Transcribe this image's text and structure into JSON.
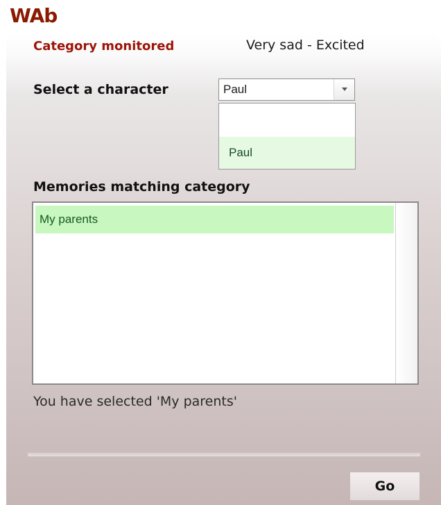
{
  "app": {
    "title": "WAb"
  },
  "category": {
    "label": "Category monitored",
    "value": "Very sad - Excited"
  },
  "character_select": {
    "label": "Select a character",
    "selected_value": "Paul",
    "options": [
      "",
      "Paul"
    ]
  },
  "memories": {
    "label": "Memories matching category",
    "items": [
      "My parents"
    ]
  },
  "status": {
    "text": "You have selected 'My parents'"
  },
  "actions": {
    "go_label": "Go"
  },
  "colors": {
    "title": "#8b1a00",
    "category_label": "#9b1508",
    "selection_highlight": "#c8f7bf",
    "dropdown_highlight": "#e6f9e3"
  }
}
